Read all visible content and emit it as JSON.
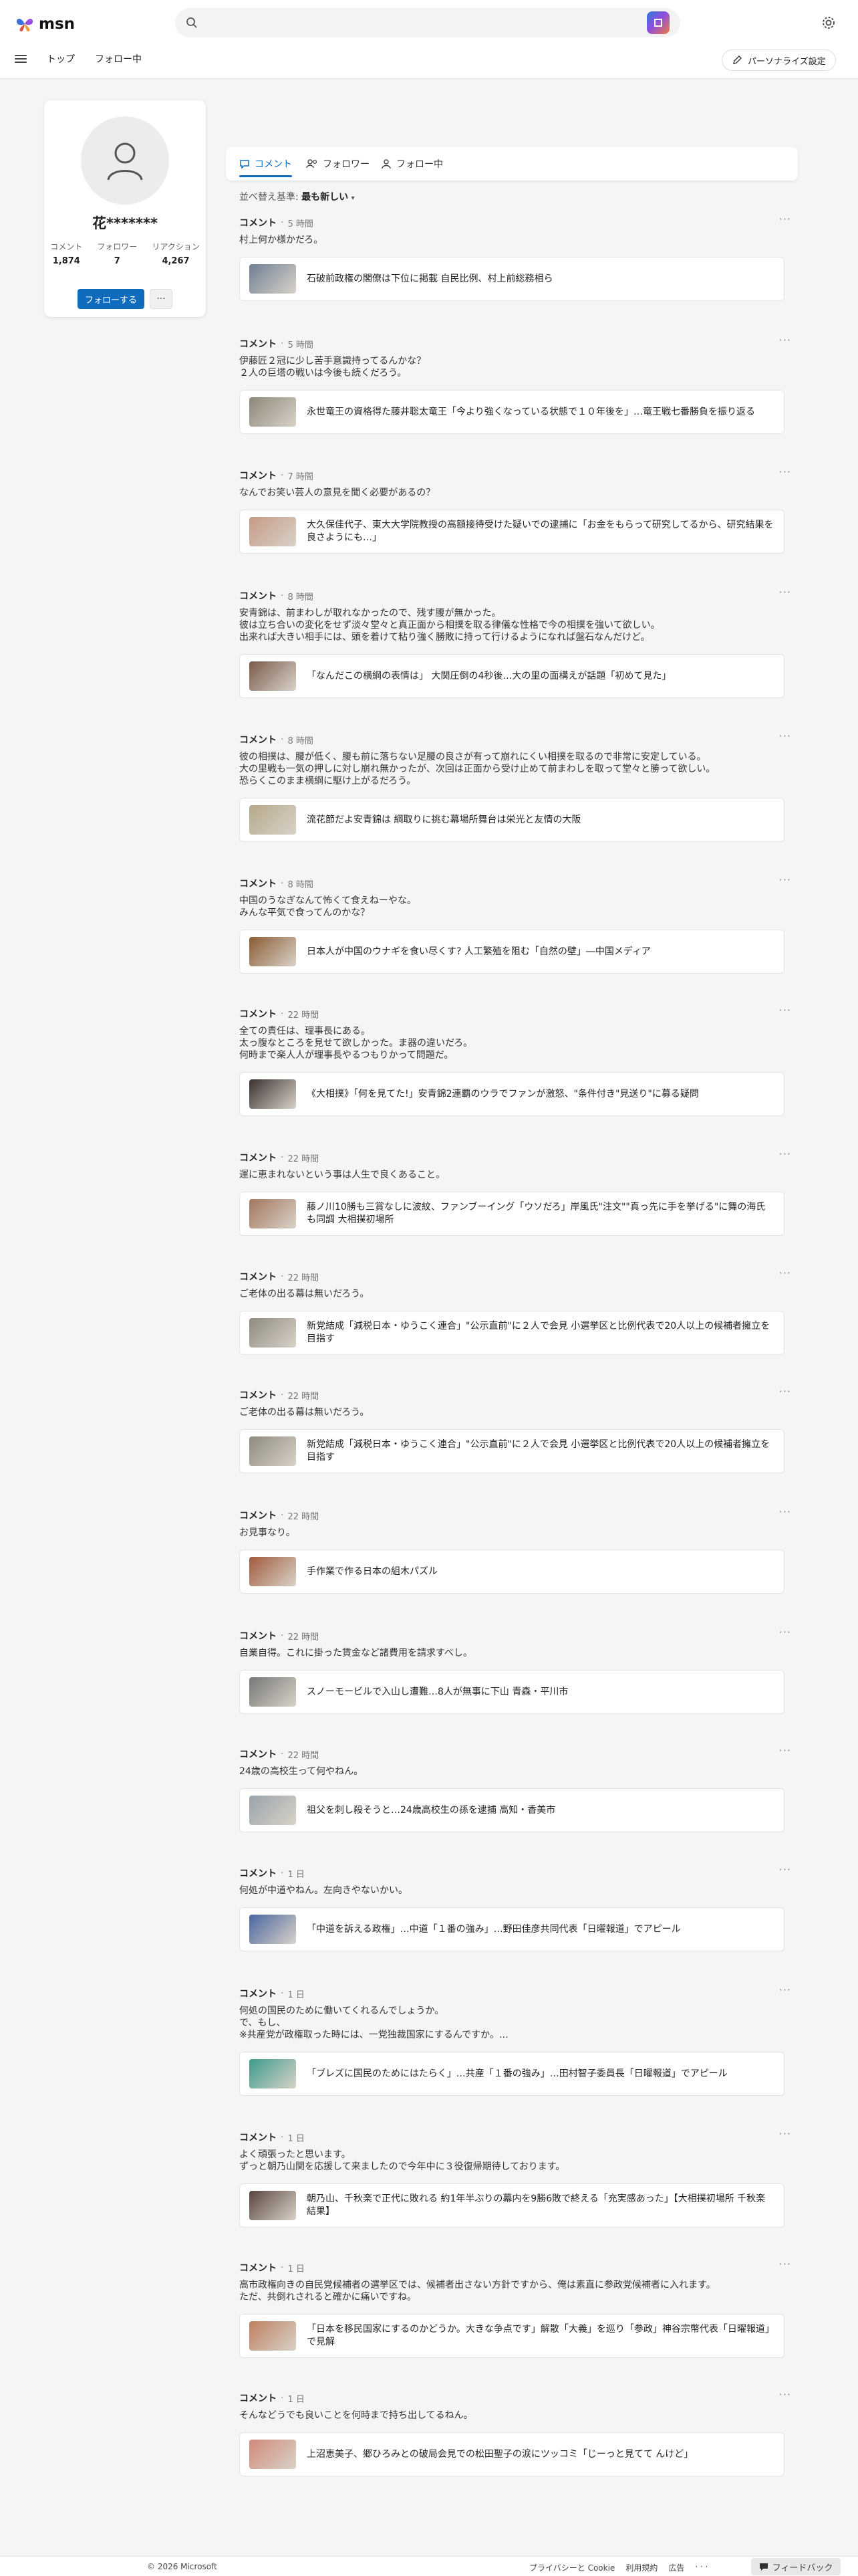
{
  "header": {
    "brand": "msn",
    "search_placeholder": "",
    "nav": [
      "トップ",
      "フォロー中"
    ],
    "personalize": "パーソナライズ設定"
  },
  "profile": {
    "name": "花*******",
    "stats": [
      {
        "label": "コメント",
        "value": "1,874"
      },
      {
        "label": "フォロワー",
        "value": "7"
      },
      {
        "label": "リアクション",
        "value": "4,267"
      }
    ],
    "follow_label": "フォローする",
    "more_label": "···"
  },
  "tabs": [
    {
      "label": "コメント"
    },
    {
      "label": "フォロワー"
    },
    {
      "label": "フォロー中"
    }
  ],
  "sort": {
    "label": "並べ替え基準:",
    "value": "最も新しい"
  },
  "colors": {
    "accent": "#0f6cbd"
  },
  "comments": [
    {
      "author": "コメント",
      "time": "5 時間",
      "text": "村上何か様かだろ。",
      "article": "石破前政権の閣僚は下位に掲載 自民比例、村上前総務相ら",
      "thumb": "#6f7f94"
    },
    {
      "author": "コメント",
      "time": "5 時間",
      "text": "伊藤匠２冠に少し苦手意識持ってるんかな？\n２人の巨塔の戦いは今後も続くだろう。",
      "article": "永世竜王の資格得た藤井聡太竜王「今より強くなっている状態で１０年後を」…竜王戦七番勝負を振り返る",
      "thumb": "#8c8878"
    },
    {
      "author": "コメント",
      "time": "7 時間",
      "text": "なんでお笑い芸人の意見を聞く必要があるの？",
      "article": "大久保佳代子、東大大学院教授の高額接待受けた疑いでの逮捕に「お金をもらって研究してるから、研究結果を良さようにも…」",
      "thumb": "#c79a86"
    },
    {
      "author": "コメント",
      "time": "8 時間",
      "text": "安青錦は、前まわしが取れなかったので、残す腰が無かった。\n彼は立ち合いの変化をせず淡々堂々と真正面から相撲を取る律儀な性格で今の相撲を強いて欲しい。\n出来れば大きい相手には、頭を着けて粘り強く勝敗に持って行けるようになれば盤石なんだけど。",
      "article": "「なんだこの横綱の表情は」 大関圧倒の4秒後…大の里の面構えが話題「初めて見た」",
      "thumb": "#7a5a4a"
    },
    {
      "author": "コメント",
      "time": "8 時間",
      "text": "彼の相撲は、腰が低く、腰も前に落ちない足腰の良さが有って崩れにくい相撲を取るので非常に安定している。\n大の里戦も一気の押しに対し崩れ無かったが、次回は正面から受け止めて前まわしを取って堂々と勝って欲しい。\n恐らくこのまま横綱に駆け上がるだろう。",
      "article": "流花節だよ安青錦は 綱取りに挑む幕場所舞台は栄光と友情の大阪",
      "thumb": "#b6a98a"
    },
    {
      "author": "コメント",
      "time": "8 時間",
      "text": "中国のうなぎなんて怖くて食えねーやな。\nみんな平気で食ってんのかな？",
      "article": "日本人が中国のウナギを食い尽くす? 人工繁殖を阻む「自然の壁」―中国メディア",
      "thumb": "#8a5a32"
    },
    {
      "author": "コメント",
      "time": "22 時間",
      "text": "全ての責任は、理事長にある。\n太っ腹なところを見せて欲しかった。ま器の違いだろ。\n何時まで楽人人が理事長やるつもりかって問題だ。",
      "article": "《大相撲》「何を見てた!」安青錦2連覇のウラでファンが激怒、\"条件付き\"見送り\"に募る疑問",
      "thumb": "#3a3130"
    },
    {
      "author": "コメント",
      "time": "22 時間",
      "text": "運に恵まれないという事は人生で良くあること。",
      "article": "藤ノ川10勝も三賞なしに波紋、ファンブーイング「ウソだろ」岸風氏\"注文\"\"真っ先に手を挙げる\"に舞の海氏も同調 大相撲初場所",
      "thumb": "#a4765e"
    },
    {
      "author": "コメント",
      "time": "22 時間",
      "text": "ご老体の出る幕は無いだろう。",
      "article": "新党結成「減税日本・ゆうこく連合」\"公示直前\"に２人で会見 小選挙区と比例代表で20人以上の候補者擁立を目指す",
      "thumb": "#8f8a80"
    },
    {
      "author": "コメント",
      "time": "22 時間",
      "text": "ご老体の出る幕は無いだろう。",
      "article": "新党結成「減税日本・ゆうこく連合」\"公示直前\"に２人で会見 小選挙区と比例代表で20人以上の候補者擁立を目指す",
      "thumb": "#8f8a80"
    },
    {
      "author": "コメント",
      "time": "22 時間",
      "text": "お見事なり。",
      "article": "手作業で作る日本の組木パズル",
      "thumb": "#a15a3c"
    },
    {
      "author": "コメント",
      "time": "22 時間",
      "text": "自業自得。これに掛った賃金など諸費用を請求すべし。",
      "article": "スノーモービルで入山し遭難…8人が無事に下山 青森・平川市",
      "thumb": "#777777"
    },
    {
      "author": "コメント",
      "time": "22 時間",
      "text": "24歳の高校生って何やねん。",
      "article": "祖父を刺し殺そうと…24歳高校生の孫を逮捕 高知・香美市",
      "thumb": "#9aa3ab"
    },
    {
      "author": "コメント",
      "time": "1 日",
      "text": "何処が中道やねん。左向きやないかい。",
      "article": "「中道を訴える政権」…中道「１番の強み」…野田佳彦共同代表「日曜報道」でアピール",
      "thumb": "#4a66a0"
    },
    {
      "author": "コメント",
      "time": "1 日",
      "text": "何処の国民のために働いてくれるんでしょうか。\nで、もし、\n※共産党が政権取った時には、一党独裁国家にするんですか。…",
      "article": "「ブレズに国民のためにはたらく」…共産「１番の強み」…田村智子委員長「日曜報道」でアピール",
      "thumb": "#3c9a8c"
    },
    {
      "author": "コメント",
      "time": "1 日",
      "text": "よく頑張ったと思います。\nずっと朝乃山関を応援して来ましたので今年中に３役復帰期待しております。",
      "article": "朝乃山、千秋楽で正代に敗れる 約1年半ぶりの幕内を9勝6敗で終える「充実感あった」【大相撲初場所 千秋楽結果】",
      "thumb": "#5a4640"
    },
    {
      "author": "コメント",
      "time": "1 日",
      "text": "高市政権向きの自民党候補者の選挙区では、候補者出さない方針ですから、俺は素直に参政党候補者に入れます。\nただ、共倒れされると確かに痛いですね。",
      "article": "「日本を移民国家にするのかどうか。大きな争点です」解散「大義」を巡り「参政」神谷宗幣代表「日曜報道」で見解",
      "thumb": "#c08060"
    },
    {
      "author": "コメント",
      "time": "1 日",
      "text": "そんなどうでも良いことを何時まで持ち出してるねん。",
      "article": "上沼恵美子、郷ひろみとの破局会見での松田聖子の涙にツッコミ「じーっと見てて んけど」",
      "thumb": "#d08a7a"
    }
  ],
  "footer": {
    "copyright": "© 2026 Microsoft",
    "links": [
      "プライバシーと Cookie",
      "利用規約",
      "広告",
      "· · ·"
    ],
    "feedback": "フィードバック"
  }
}
